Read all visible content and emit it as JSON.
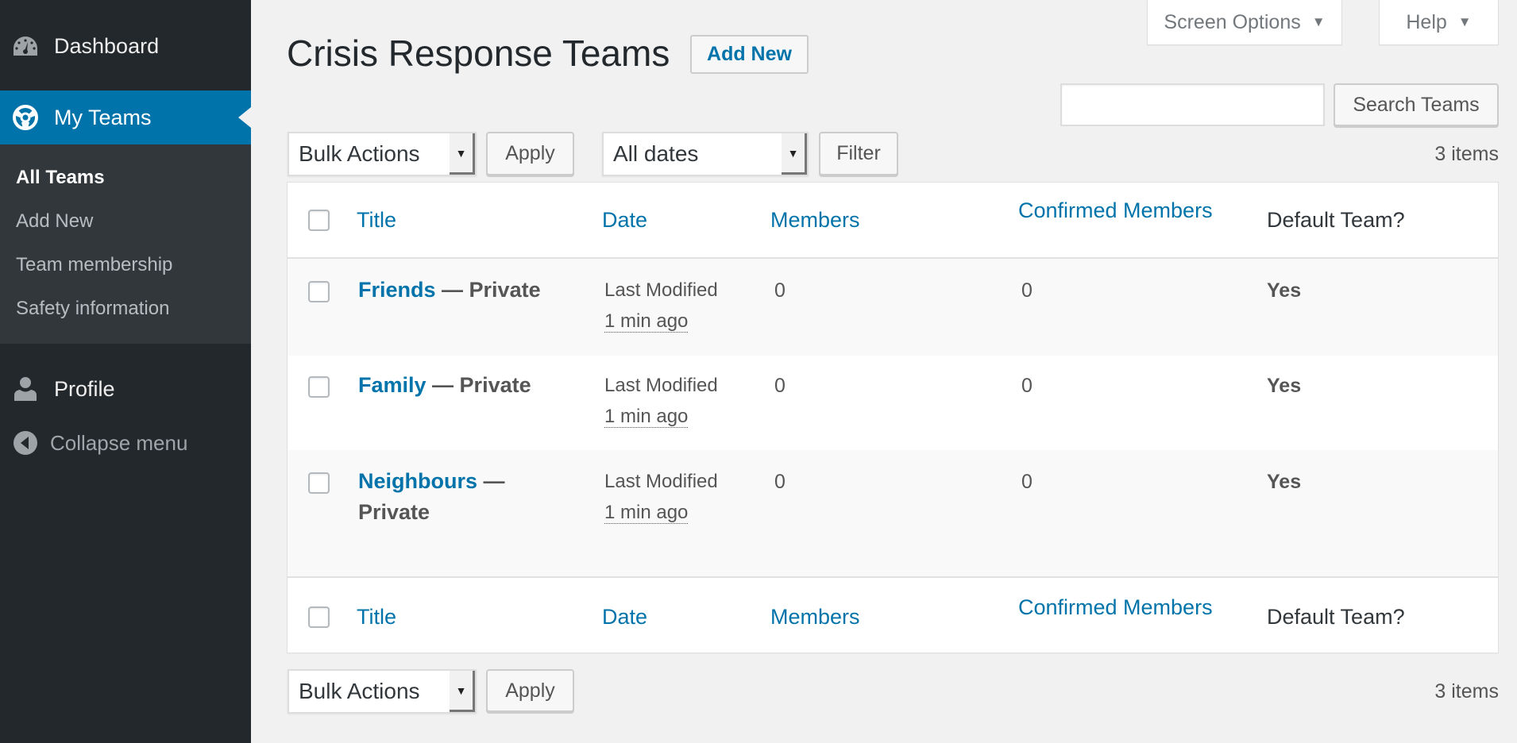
{
  "sidebar": {
    "dashboard": "Dashboard",
    "my_teams": "My Teams",
    "submenu": [
      "All Teams",
      "Add New",
      "Team membership",
      "Safety information"
    ],
    "profile": "Profile",
    "collapse": "Collapse menu"
  },
  "top_tabs": {
    "screen_options": "Screen Options",
    "help": "Help",
    "arrow": "▼"
  },
  "page": {
    "title": "Crisis Response Teams",
    "add_new": "Add New"
  },
  "search": {
    "value": "",
    "button": "Search Teams"
  },
  "tablenav": {
    "bulk_actions": "Bulk Actions",
    "apply": "Apply",
    "dates": "All dates",
    "filter": "Filter",
    "count": "3 items",
    "dropdown_arrow": "▼"
  },
  "table": {
    "columns": [
      "Title",
      "Date",
      "Members",
      "Confirmed Members",
      "Default Team?"
    ],
    "rows": [
      {
        "title": "Friends",
        "state": " — Private",
        "date_label": "Last Modified",
        "date_value": "1 min ago",
        "members": "0",
        "confirmed": "0",
        "default": "Yes"
      },
      {
        "title": "Family",
        "state": " — Private",
        "date_label": "Last Modified",
        "date_value": "1 min ago",
        "members": "0",
        "confirmed": "0",
        "default": "Yes"
      },
      {
        "title": "Neighbours",
        "state": " — Private",
        "date_label": "Last Modified",
        "date_value": "1 min ago",
        "members": "0",
        "confirmed": "0",
        "default": "Yes"
      }
    ]
  },
  "colors": {
    "sidebar_bg": "#23282d",
    "submenu_bg": "#32373c",
    "accent": "#0073aa",
    "page_bg": "#f1f1f1"
  }
}
